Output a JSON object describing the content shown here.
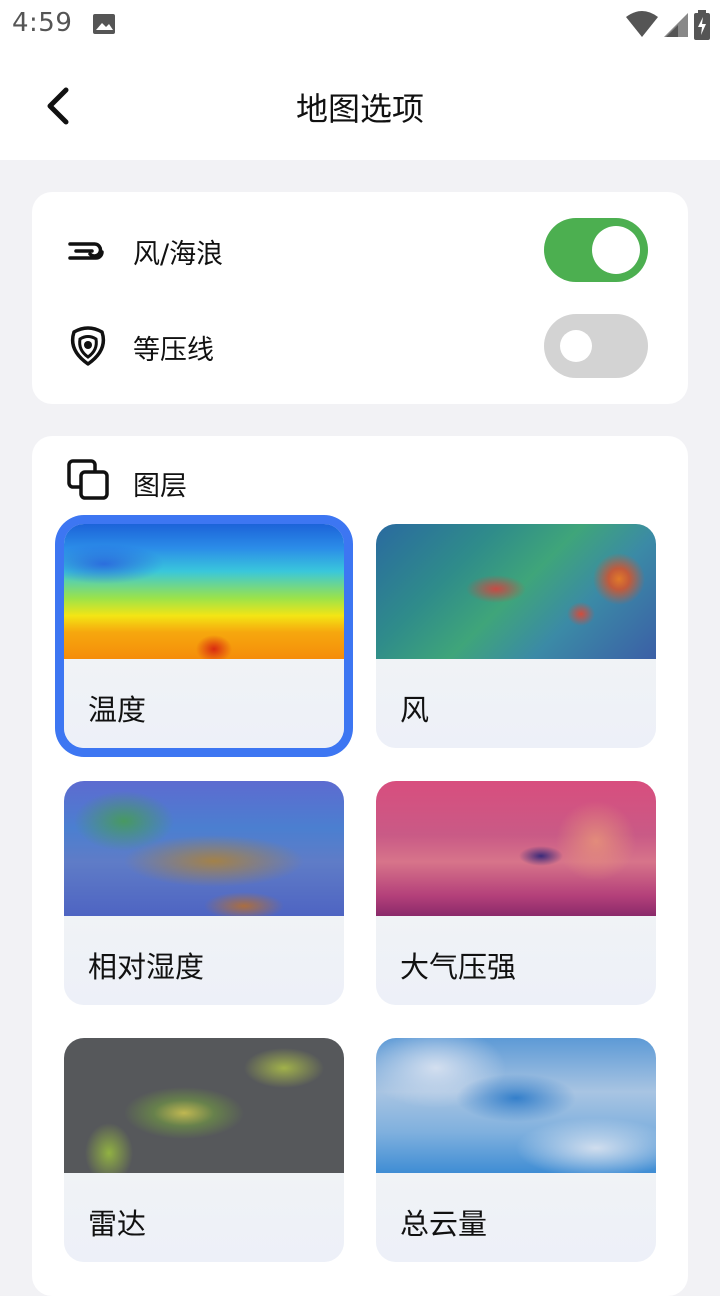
{
  "status_bar": {
    "time": "4:59"
  },
  "header": {
    "title": "地图选项"
  },
  "toggles": [
    {
      "label": "风/海浪",
      "icon": "wind-icon",
      "enabled": true
    },
    {
      "label": "等压线",
      "icon": "isobar-icon",
      "enabled": false
    }
  ],
  "layers": {
    "title": "图层",
    "selected": "温度",
    "items": [
      {
        "label": "温度"
      },
      {
        "label": "风"
      },
      {
        "label": "相对湿度"
      },
      {
        "label": "大气压强"
      },
      {
        "label": "雷达"
      },
      {
        "label": "总云量"
      }
    ]
  },
  "colors": {
    "accent_selected": "#3d76f2",
    "switch_on": "#4caf50",
    "switch_off": "#d3d3d3"
  }
}
